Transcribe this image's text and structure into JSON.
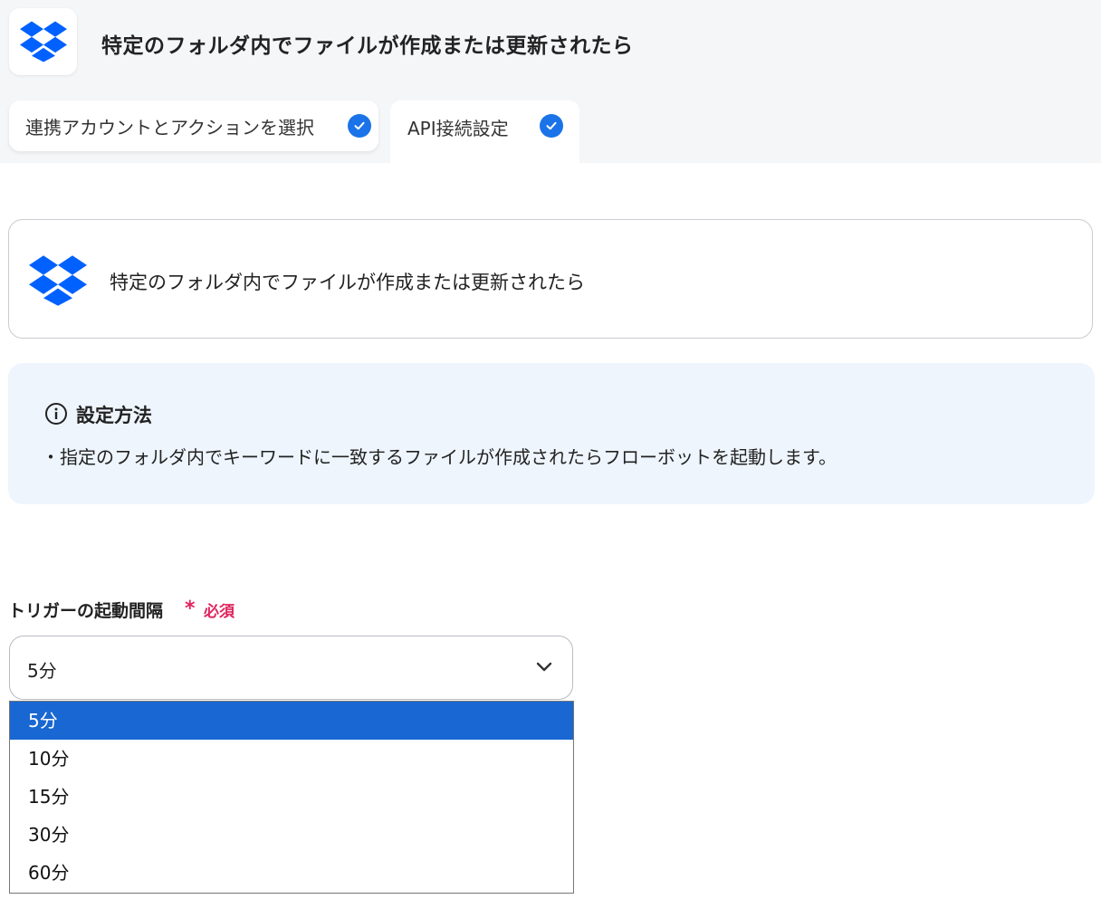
{
  "header": {
    "title": "特定のフォルダ内でファイルが作成または更新されたら",
    "logo_icon": "dropbox-logo-icon"
  },
  "tabs": [
    {
      "label": "連携アカウントとアクションを選択",
      "completed": true
    },
    {
      "label": "API接続設定",
      "completed": true
    }
  ],
  "trigger_card": {
    "title": "特定のフォルダ内でファイルが作成または更新されたら",
    "icon": "dropbox-logo-icon"
  },
  "info": {
    "title": "設定方法",
    "text": "・指定のフォルダ内でキーワードに一致するファイルが作成されたらフローボットを起動します。",
    "icon": "info-circle-icon"
  },
  "interval_field": {
    "label": "トリガーの起動間隔",
    "required_star": "*",
    "required_text": "必須",
    "value": "5分",
    "options": [
      "5分",
      "10分",
      "15分",
      "30分",
      "60分"
    ],
    "selected_index": 0
  },
  "colors": {
    "accent": "#1a73e8",
    "dropbox": "#0061fe",
    "required": "#e0245e",
    "selected_option": "#1967d2",
    "info_bg": "#eef5fd"
  }
}
